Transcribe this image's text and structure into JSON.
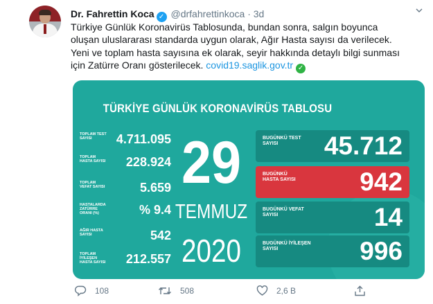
{
  "author": {
    "name": "Dr. Fahrettin Koca",
    "handle": "@drfahrettinkoca",
    "separator": "·",
    "time": "3d"
  },
  "tweet": {
    "line1": "Türkiye Günlük Koronavirüs Tablosunda, bundan sonra, salgın boyunca",
    "line2": "oluşan uluslararası standarda uygun olarak, Ağır Hasta sayısı da verilecek.",
    "line3": "Yeni ve toplam hasta sayısına ek olarak, seyir hakkında detaylı bilgi sunması",
    "line4": "için Zatürre Oranı gösterilecek.",
    "link": "covid19.saglik.gov.tr"
  },
  "card": {
    "title": "TÜRKİYE GÜNLÜK KORONAVİRÜS TABLOSU",
    "day": "29",
    "month": "TEMMUZ",
    "year": "2020",
    "totals": [
      {
        "label": "TOPLAM TEST SAYISI",
        "value": "4.711.095"
      },
      {
        "label": "TOPLAM HASTA SAYISI",
        "value": "228.924"
      },
      {
        "label": "TOPLAM VEFAT SAYISI",
        "value": "5.659"
      },
      {
        "label": "HASTALARDA ZATÜRRE ORANI (%)",
        "value": "% 9.4"
      },
      {
        "label": "AĞIR HASTA SAYISI",
        "value": "542"
      },
      {
        "label": "TOPLAM İYİLEŞEN HASTA SAYISI",
        "value": "212.557"
      }
    ],
    "today": [
      {
        "label": "BUGÜNKÜ TEST SAYISI",
        "value": "45.712"
      },
      {
        "label": "BUGÜNKÜ HASTA SAYISI",
        "value": "942"
      },
      {
        "label": "BUGÜNKÜ VEFAT SAYISI",
        "value": "14"
      },
      {
        "label": "BUGÜNKÜ İYİLEŞEN SAYISI",
        "value": "996"
      }
    ],
    "colors": {
      "background": "#1fa89d",
      "row_dark": "#168a81",
      "row_red": "#d9363e"
    }
  },
  "actions": {
    "replies": "108",
    "retweets": "508",
    "likes": "2,6 B"
  }
}
